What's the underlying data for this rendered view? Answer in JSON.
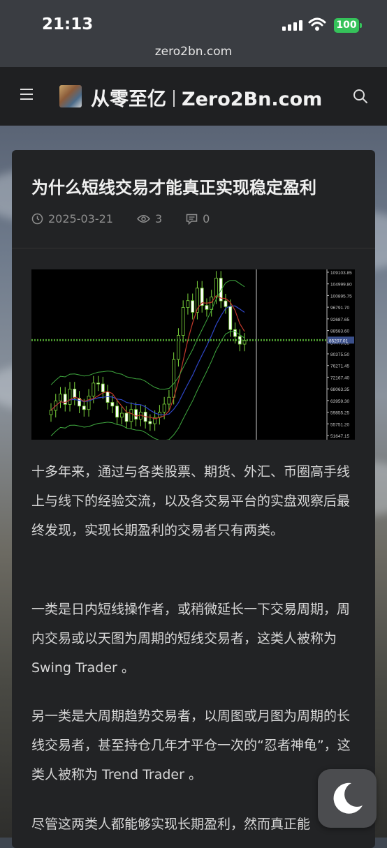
{
  "status_bar": {
    "time": "21:13",
    "battery": "100"
  },
  "browser": {
    "url": "zero2bn.com"
  },
  "header": {
    "site_name": "从零至亿",
    "site_domain": "Zero2Bn.com"
  },
  "article": {
    "title": "为什么短线交易才能真正实现稳定盈利",
    "date": "2025-03-21",
    "views": "3",
    "comments": "0",
    "paragraphs": [
      "十多年来，通过与各类股票、期货、外汇、币圈高手线上与线下的经验交流，以及各交易平台的实盘观察后最终发现，实现长期盈利的交易者只有两类。",
      "一类是日内短线操作者，或稍微延长一下交易周期，周内交易或以天图为周期的短线交易者，这类人被称为Swing Trader 。",
      "另一类是大周期趋势交易者，以周图或月图为周期的长线交易者，甚至持仓几年才平仓一次的“忍者神龟”，这类人被称为 Trend Trader 。",
      "尽管这两类人都能够实现长期盈利，然而真正能"
    ]
  },
  "chart_data": {
    "type": "line",
    "title": "",
    "y_ticks": [
      "109103.85",
      "104999.80",
      "100895.75",
      "96791.70",
      "92687.65",
      "88583.60",
      "84479.55",
      "80375.50",
      "76271.45",
      "72167.40",
      "68063.35",
      "63959.30",
      "59855.25",
      "55751.20",
      "51647.15"
    ],
    "current_price_label": "85207.01",
    "ylim": [
      51647.15,
      109103.85
    ],
    "candles_close": [
      60500,
      63800,
      66200,
      62600,
      68000,
      64800,
      62000,
      60800,
      65500,
      70100,
      69800,
      67000,
      63300,
      62000,
      58100,
      59500,
      56600,
      60800,
      57400,
      59900,
      56600,
      55800,
      58000,
      59900,
      62700,
      65100,
      78400,
      86900,
      96700,
      99100,
      95000,
      103500,
      97400,
      96000,
      100400,
      107000,
      99000,
      97000,
      88900,
      86500,
      83800,
      85200
    ],
    "colors": {
      "candles": "#7cd63c",
      "upper_band": "#3fa83f",
      "ma_fast": "#c0392b",
      "ma_slow": "#2e46c8",
      "grid": "#4b9a2e"
    }
  },
  "ui": {
    "moon_icon": "moon-icon"
  }
}
